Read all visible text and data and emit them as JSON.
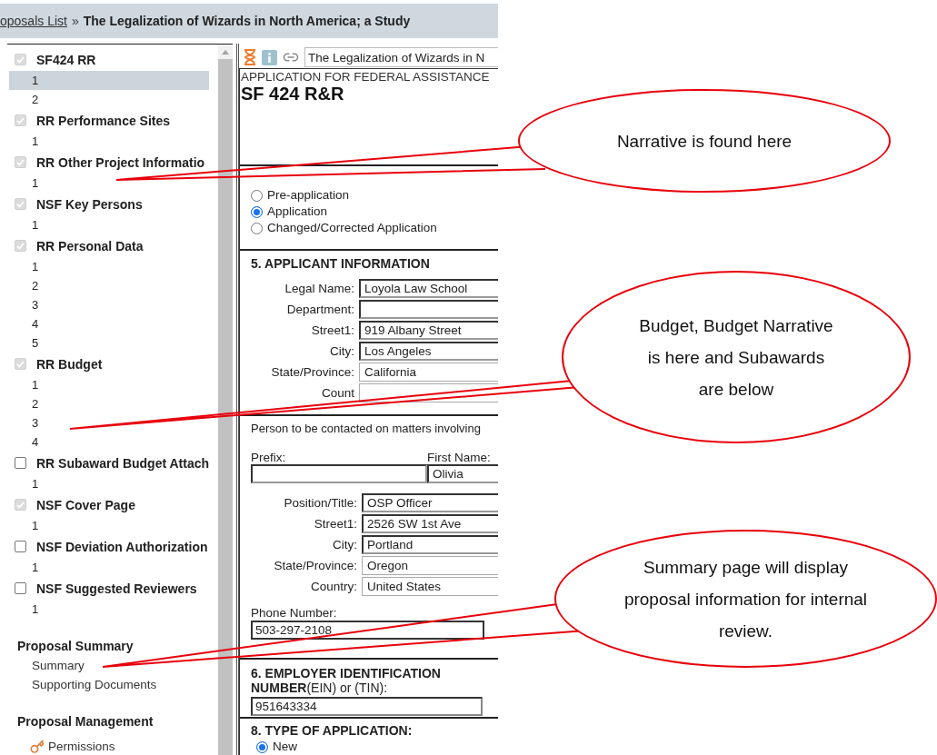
{
  "breadcrumb": {
    "link": "oposals List",
    "separator": "»",
    "title": "The Legalization of Wizards in North America; a Study"
  },
  "sidebar": {
    "forms": [
      {
        "label": "SF424 RR",
        "checked": true,
        "pages": [
          {
            "label": "1",
            "selected": true
          },
          {
            "label": "2",
            "selected": false
          }
        ]
      },
      {
        "label": "RR Performance Sites",
        "checked": true,
        "pages": [
          {
            "label": "1",
            "selected": false
          }
        ]
      },
      {
        "label": "RR Other Project Informatio",
        "checked": true,
        "pages": [
          {
            "label": "1",
            "selected": false
          }
        ]
      },
      {
        "label": "NSF Key Persons",
        "checked": true,
        "pages": [
          {
            "label": "1",
            "selected": false
          }
        ]
      },
      {
        "label": "RR Personal Data",
        "checked": true,
        "pages": [
          {
            "label": "1",
            "selected": false
          },
          {
            "label": "2",
            "selected": false
          },
          {
            "label": "3",
            "selected": false
          },
          {
            "label": "4",
            "selected": false
          },
          {
            "label": "5",
            "selected": false
          }
        ]
      },
      {
        "label": "RR Budget",
        "checked": true,
        "pages": [
          {
            "label": "1",
            "selected": false
          },
          {
            "label": "2",
            "selected": false
          },
          {
            "label": "3",
            "selected": false
          },
          {
            "label": "4",
            "selected": false
          }
        ]
      },
      {
        "label": "RR Subaward Budget Attach",
        "checked": false,
        "pages": [
          {
            "label": "1",
            "selected": false
          }
        ]
      },
      {
        "label": "NSF Cover Page",
        "checked": true,
        "pages": [
          {
            "label": "1",
            "selected": false
          }
        ]
      },
      {
        "label": "NSF Deviation Authorization",
        "checked": false,
        "pages": [
          {
            "label": "1",
            "selected": false
          }
        ]
      },
      {
        "label": "NSF Suggested Reviewers",
        "checked": false,
        "pages": [
          {
            "label": "1",
            "selected": false
          }
        ]
      }
    ],
    "sections": [
      {
        "heading": "Proposal Summary",
        "links": [
          {
            "label": "Summary"
          },
          {
            "label": "Supporting Documents"
          }
        ]
      },
      {
        "heading": "Proposal Management",
        "links": [
          {
            "label": "Permissions",
            "kind": "key"
          }
        ]
      }
    ]
  },
  "form": {
    "title_field": "The Legalization of Wizards in N",
    "subtitle": "APPLICATION FOR FEDERAL ASSISTANCE",
    "title": "SF 424 R&R",
    "submission_types": [
      {
        "label": "Pre-application",
        "selected": false
      },
      {
        "label": "Application",
        "selected": true
      },
      {
        "label": "Changed/Corrected Application",
        "selected": false
      }
    ],
    "applicant": {
      "heading": "5. APPLICANT INFORMATION",
      "fields": [
        {
          "label": "Legal Name:",
          "value": "Loyola Law School",
          "kind": "text"
        },
        {
          "label": "Department:",
          "kind": "text"
        },
        {
          "label": "Street1:",
          "value": "919 Albany Street",
          "kind": "text"
        },
        {
          "label": "City:",
          "value": "Los Angeles",
          "kind": "text"
        },
        {
          "label": "State/Province:",
          "value": "California",
          "kind": "select"
        },
        {
          "label": "Count",
          "kind": "select"
        }
      ]
    },
    "contact": {
      "note": "Person to be contacted on matters involving",
      "prefix_label": "Prefix:",
      "first_name_label": "First Name:",
      "first_name": "Olivia",
      "fields": [
        {
          "label": "Position/Title:",
          "value": "OSP Officer",
          "kind": "text"
        },
        {
          "label": "Street1:",
          "value": "2526 SW 1st Ave",
          "kind": "text"
        },
        {
          "label": "City:",
          "value": "Portland",
          "kind": "text"
        },
        {
          "label": "State/Province:",
          "value": "Oregon",
          "kind": "select"
        },
        {
          "label": "Country:",
          "value": "United States",
          "kind": "select"
        }
      ],
      "phone_label": "Phone Number:",
      "phone": "503-297-2108"
    },
    "ein": {
      "heading": "**6. EMPLOYER IDENTIFICATION NUMBER**(EIN) or (TIN):",
      "value": "951643334"
    },
    "application_type": {
      "heading": "8. TYPE OF APPLICATION:",
      "options": [
        {
          "label": "New",
          "selected": true
        }
      ]
    }
  },
  "callouts": [
    {
      "text": "Narrative is found here"
    },
    {
      "text": "Budget, Budget Narrative is here and Subawards are below"
    },
    {
      "text": "Summary page will display proposal information for internal review."
    }
  ]
}
